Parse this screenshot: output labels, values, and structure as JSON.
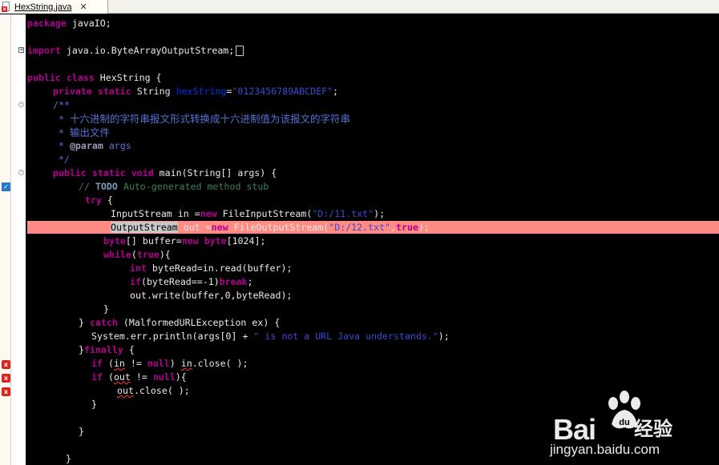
{
  "tab": {
    "filename": "HexString.java"
  },
  "code": {
    "l1": {
      "kw": "package",
      "rest": " javaIO;"
    },
    "l2": {
      "kw": "import",
      "rest": " java.io.ByteArrayOutputStream;"
    },
    "l3": {
      "kw1": "public",
      "kw2": "class",
      "rest": " HexString {"
    },
    "l4": {
      "kw1": "private",
      "kw2": "static",
      "type": " String ",
      "field": "hexString",
      "eq": "=",
      "str": "\"0123456789ABCDEF\"",
      "end": ";"
    },
    "l5": {
      "text": "/**"
    },
    "l6": {
      "star": " * ",
      "cn": "十六进制的字符串报文形式转换成十六进制值为该报文的字符串"
    },
    "l7": {
      "star": " * ",
      "cn": "输出文件"
    },
    "l8": {
      "star": " * ",
      "tag": "@param",
      "rest": " args"
    },
    "l9": {
      "text": " */"
    },
    "l10": {
      "kw1": "public",
      "kw2": "static",
      "kw3": "void",
      "rest": " main(String[] args) {"
    },
    "l11": {
      "slashes": "// ",
      "task": "TODO",
      "rest": " Auto-generated method stub"
    },
    "l12": {
      "kw": "try",
      "rest": " {"
    },
    "l13": {
      "a": "InputStream in =",
      "kw": "new",
      "b": " FileInputStream(",
      "str": "\"D:/11.txt\"",
      "c": ");"
    },
    "l14": {
      "sel": "OutputStream",
      "a": " out =",
      "kw": "new",
      "b": " FileOutputStream(",
      "str": "\"D:/12.txt\"",
      "c": ",",
      "kw2": "true",
      "d": ");"
    },
    "l15": {
      "kw": "byte",
      "a": "[] buffer=",
      "kw2": "new",
      "b": " ",
      "kw3": "byte",
      "c": "[1024];"
    },
    "l16": {
      "kw": "while",
      "a": "(",
      "kw2": "true",
      "b": "){"
    },
    "l17": {
      "kw": "int",
      "a": " byteRead=in.read(buffer);"
    },
    "l18": {
      "kw": "if",
      "a": "(byteRead==-1)",
      "kw2": "break",
      "b": ";"
    },
    "l19": {
      "a": "out.write(buffer,0,byteRead);"
    },
    "l20": {
      "a": "}"
    },
    "l21": {
      "a": "} ",
      "kw": "catch",
      "b": " (MalformedURLException ex) {"
    },
    "l22": {
      "a": "System.err.println(args[0] + ",
      "str": "\" is not a URL Java understands.\"",
      "b": ");"
    },
    "l23": {
      "a": "}",
      "kw": "finally",
      "b": " {"
    },
    "l24": {
      "kw": "if",
      "a": " (",
      "err": "in",
      "b": " != ",
      "kw2": "null",
      "c": ") ",
      "err2": "in",
      "d": ".close( );"
    },
    "l25": {
      "kw": "if",
      "a": " (",
      "err": "out",
      "b": " != ",
      "kw2": "null",
      "c": "){"
    },
    "l26": {
      "err": "out",
      "a": ".close( );"
    },
    "l27": {
      "a": "}"
    },
    "l28": {
      "a": "}"
    },
    "l29": {
      "a": "}"
    }
  },
  "watermark": {
    "brand_left": "Bai",
    "brand_right": "du",
    "brand_cn": "经验",
    "url": "jingyan.baidu.com"
  }
}
